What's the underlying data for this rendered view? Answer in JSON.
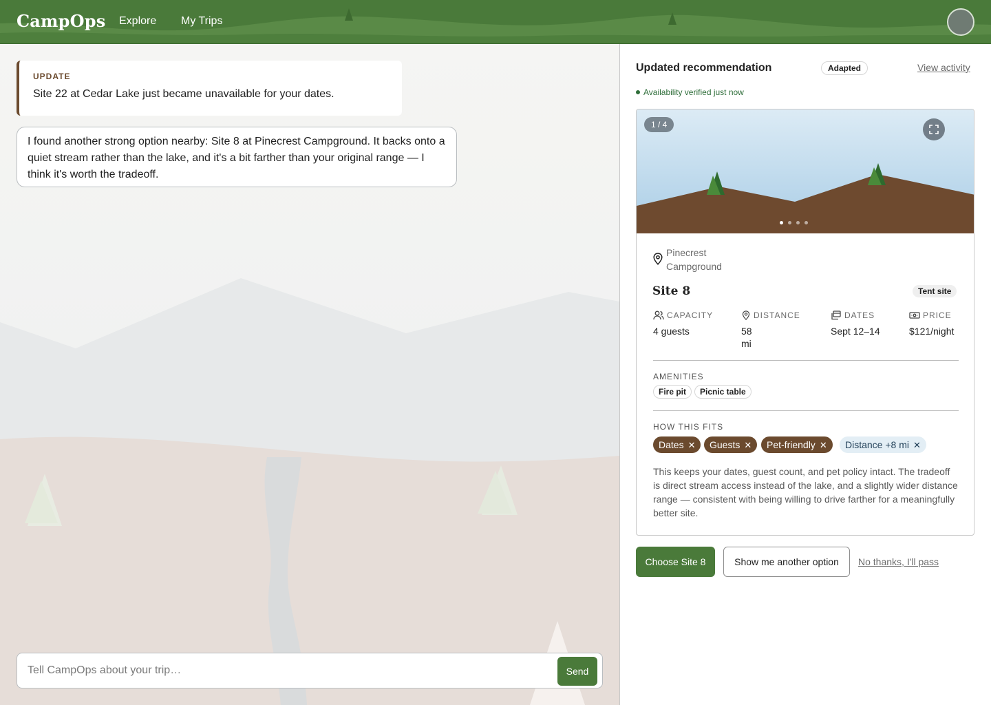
{
  "app": {
    "name": "CampOps"
  },
  "nav": {
    "explore": "Explore",
    "my_trips": "My Trips"
  },
  "chat": {
    "update_label": "UPDATE",
    "update_text": "Site 22 at Cedar Lake just became unavailable for your dates.",
    "assistant_message": "I found another strong option nearby: Site 8 at Pinecrest Campground. It backs onto a quiet stream rather than the lake, and it's a bit farther than your original range — I think it's worth the tradeoff.",
    "composer_placeholder": "Tell CampOps about your trip…",
    "send_label": "Send"
  },
  "panel": {
    "title": "Updated recommendation",
    "badge": "Adapted",
    "view_activity": "View activity",
    "verified": "Availability verified just now",
    "photo_counter": "1 / 4",
    "photo_index": 1,
    "photo_total": 4,
    "location": "Pinecrest Campground",
    "site_name": "Site 8",
    "site_type": "Tent site",
    "stats": {
      "capacity": {
        "label": "CAPACITY",
        "value": "4 guests",
        "icon": "people-icon"
      },
      "distance": {
        "label": "DISTANCE",
        "value": "58 mi",
        "icon": "pin-icon"
      },
      "dates": {
        "label": "DATES",
        "value": "Sept 12–14",
        "icon": "calendar-icon"
      },
      "price": {
        "label": "PRICE",
        "value": "$121/night",
        "icon": "cash-icon"
      }
    },
    "amenities_label": "AMENITIES",
    "amenities": [
      "Fire pit",
      "Picnic table"
    ],
    "fits_label": "HOW THIS FITS",
    "fits": [
      {
        "label": "Dates",
        "kind": "kept"
      },
      {
        "label": "Guests",
        "kind": "kept"
      },
      {
        "label": "Pet-friendly",
        "kind": "kept"
      },
      {
        "label": "Distance +8 mi",
        "kind": "changed"
      }
    ],
    "explanation": "This keeps your dates, guest count, and pet policy intact. The tradeoff is direct stream access instead of the lake, and a slightly wider distance range — consistent with being willing to drive farther for a meaningfully better site.",
    "actions": {
      "choose": "Choose Site 8",
      "another": "Show me another option",
      "pass": "No thanks, I'll pass"
    }
  },
  "colors": {
    "header_green": "#4a7a3a",
    "accent_brown": "#6b4a2e",
    "verified_green": "#2f6e3a",
    "changed_tag_bg": "#e3eef5"
  }
}
